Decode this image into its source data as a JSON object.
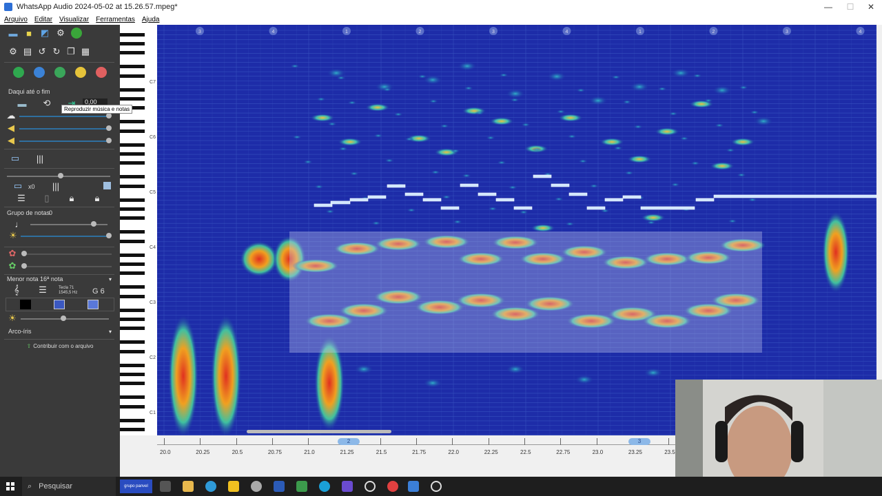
{
  "window": {
    "title": "WhatsApp Audio 2024-05-02 at 15.26.57.mpeg*",
    "minimize": "—",
    "maximize": "☐",
    "close": "✕"
  },
  "menu": [
    "Arquivo",
    "Editar",
    "Visualizar",
    "Ferramentas",
    "Ajuda"
  ],
  "panel": {
    "range_label": "Daqui até o fim",
    "position_value": "0,00",
    "tooltip": "Reproduzir música e notas",
    "zoom_label": "x0",
    "group_label": "Grupo de notas",
    "group_value": "0",
    "min_note_label": "Menor nota",
    "min_note_value": "16ª nota",
    "key_info": "Tecla 71",
    "freq_info": "1545,5 Hz",
    "note_name": "G 6",
    "colormap": "Arco-íris",
    "contribute": "Contribuir com o arquivo"
  },
  "piano": {
    "octaves": [
      "C7",
      "C6",
      "C5",
      "C4",
      "C3",
      "C2",
      "C1"
    ]
  },
  "timeline": {
    "ticks": [
      "20.0",
      "20.25",
      "20.5",
      "20.75",
      "21.0",
      "21.25",
      "21.5",
      "21.75",
      "22.0",
      "22.25",
      "22.5",
      "22.75",
      "23.0",
      "23.25",
      "23.5"
    ],
    "markers": [
      "2",
      "3"
    ]
  },
  "bar_numbers": [
    "3",
    "4",
    "1",
    "2",
    "3",
    "4",
    "1",
    "2",
    "3",
    "4"
  ],
  "taskbar": {
    "search_placeholder": "Pesquisar",
    "brand": "grupo panvel"
  },
  "colors": {
    "spectro_bg": "#1b2aa5",
    "note_fill": "#cfe6ff",
    "panel_bg": "#3a3a3a"
  }
}
